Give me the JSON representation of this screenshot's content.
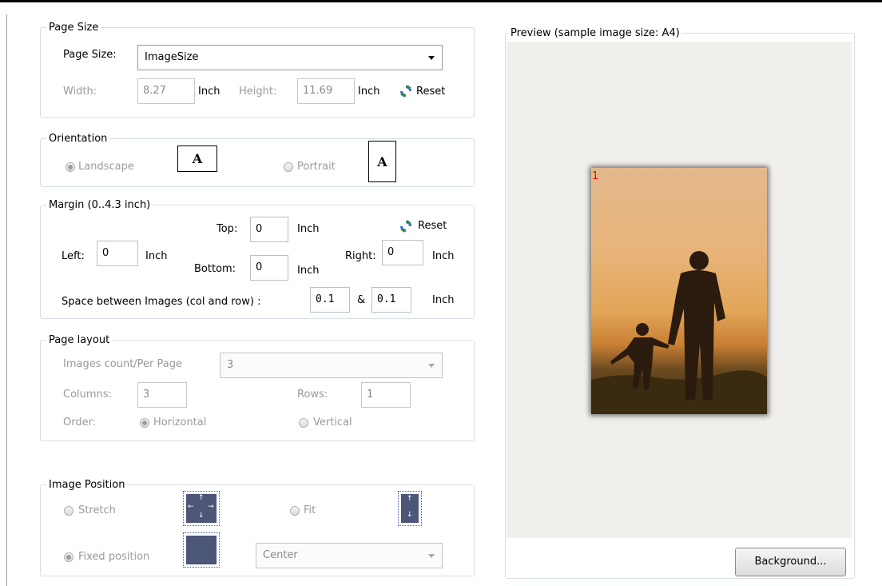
{
  "page_size": {
    "legend": "Page Size",
    "page_size_label": "Page Size:",
    "page_size_value": "ImageSize",
    "width_label": "Width:",
    "width_value": "8.27",
    "width_unit": "Inch",
    "height_label": "Height:",
    "height_value": "11.69",
    "height_unit": "Inch",
    "reset_label": "Reset"
  },
  "orientation": {
    "legend": "Orientation",
    "landscape_label": "Landscape",
    "landscape_checked": true,
    "portrait_label": "Portrait",
    "page_icon_letter": "A"
  },
  "margin": {
    "legend": "Margin (0..4.3 inch)",
    "top_label": "Top:",
    "top_value": "0",
    "top_unit": "Inch",
    "reset_label": "Reset",
    "left_label": "Left:",
    "left_value": "0",
    "left_unit": "Inch",
    "right_label": "Right:",
    "right_value": "0",
    "right_unit": "Inch",
    "bottom_label": "Bottom:",
    "bottom_value": "0",
    "bottom_unit": "Inch",
    "space_label": "Space between Images (col and row) :",
    "space_col": "0.1",
    "space_amp": "&",
    "space_row": "0.1",
    "space_unit": "Inch"
  },
  "page_layout": {
    "legend": "Page layout",
    "count_label": "Images count/Per Page",
    "count_value": "3",
    "columns_label": "Columns:",
    "columns_value": "3",
    "rows_label": "Rows:",
    "rows_value": "1",
    "order_label": "Order:",
    "horizontal_label": "Horizontal",
    "vertical_label": "Vertical"
  },
  "image_position": {
    "legend": "Image Position",
    "stretch_label": "Stretch",
    "fit_label": "Fit",
    "fixed_label": "Fixed position",
    "position_value": "Center"
  },
  "preview": {
    "legend": "Preview (sample image size: A4)",
    "page_number": "1",
    "background_button": "Background..."
  },
  "icons": [
    "reset-icon",
    "landscape-page-icon",
    "portrait-page-icon",
    "stretch-icon",
    "fit-icon",
    "fixed-position-icon",
    "dropdown-arrow-icon"
  ],
  "colors": {
    "accent": "#3a6fcf",
    "icon_fill": "#4c5677",
    "preview_bg": "#f0efec",
    "page_number": "#ff0000"
  }
}
